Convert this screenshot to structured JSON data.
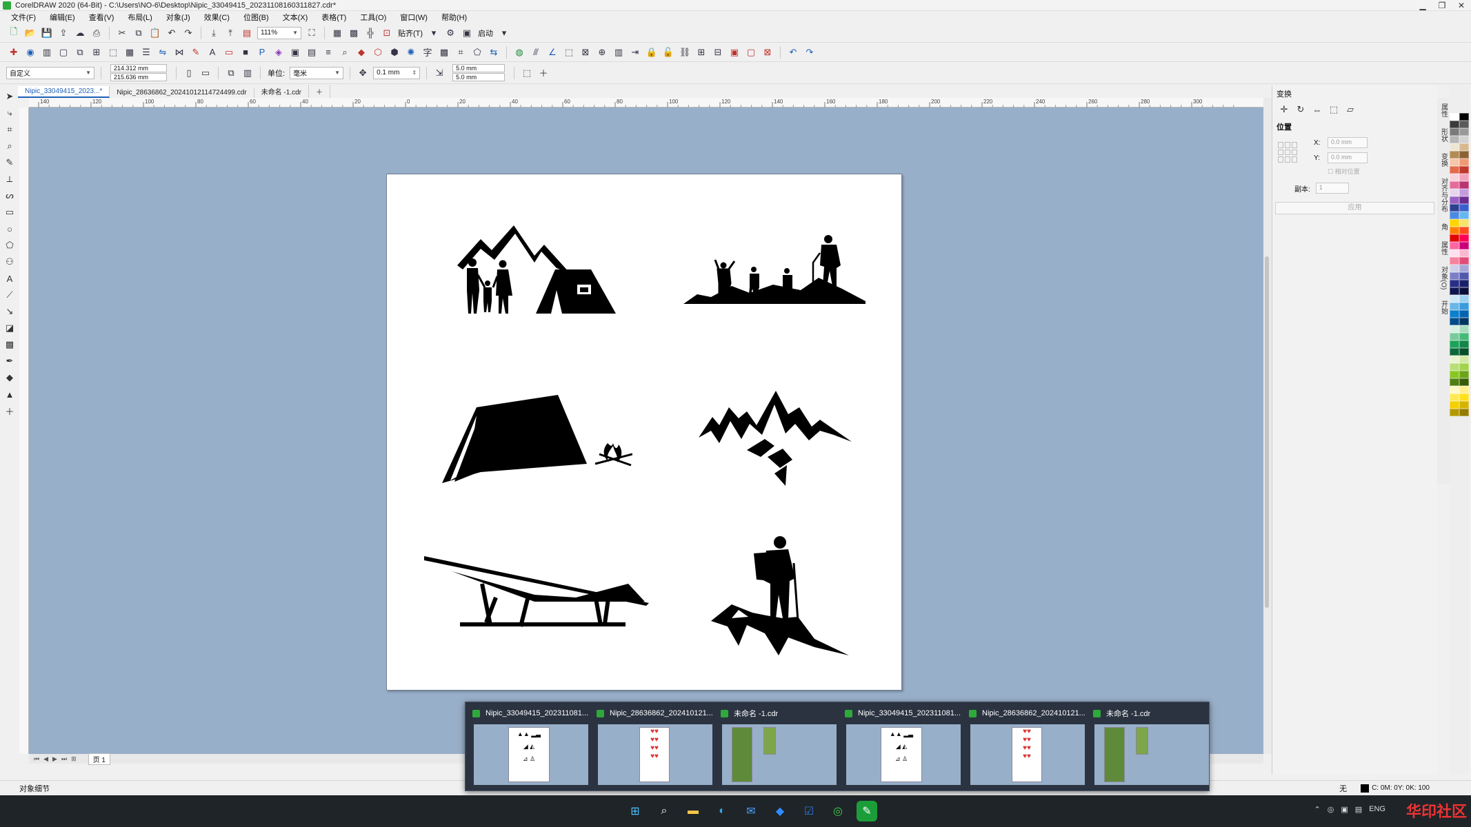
{
  "window": {
    "title": "CorelDRAW 2020 (64-Bit) - C:\\Users\\NO-6\\Desktop\\Nipic_33049415_20231108160311827.cdr*",
    "controls": [
      "▁",
      "❐",
      "✕"
    ]
  },
  "menu": [
    "文件(F)",
    "编辑(E)",
    "查看(V)",
    "布局(L)",
    "对象(J)",
    "效果(C)",
    "位图(B)",
    "文本(X)",
    "表格(T)",
    "工具(O)",
    "窗口(W)",
    "帮助(H)"
  ],
  "toolbar": {
    "zoom": "111%",
    "snap_label": "贴齐(T)",
    "launch_label": "启动"
  },
  "propbar": {
    "page_preset": "自定义",
    "width": "214.312 mm",
    "height": "215.636 mm",
    "unit_label": "单位:",
    "unit_value": "毫米",
    "nudge": "0.1 mm",
    "dup_x": "5.0 mm",
    "dup_y": "5.0 mm"
  },
  "doc_tabs": [
    {
      "label": "Nipic_33049415_2023...*",
      "active": true
    },
    {
      "label": "Nipic_28636862_20241012114724499.cdr",
      "active": false
    },
    {
      "label": "未命名 -1.cdr",
      "active": false
    }
  ],
  "ruler_top_labels": [
    "140",
    "120",
    "100",
    "80",
    "60",
    "40",
    "20",
    "0",
    "20",
    "40",
    "60",
    "80",
    "100",
    "120",
    "140",
    "160",
    "180",
    "200",
    "220",
    "240",
    "260",
    "280",
    "300"
  ],
  "page_nav": {
    "page_label": "页 1"
  },
  "docker": {
    "title": "变换",
    "section": "位置",
    "x_label": "X:",
    "x_value": "0.0 mm",
    "y_label": "Y:",
    "y_value": "0.0 mm",
    "relative_label": "相对位置",
    "copies_label": "副本:",
    "copies_value": "1",
    "apply_label": "应用"
  },
  "side_tabs": [
    "属性",
    "形状",
    "变换",
    "对齐与分布",
    "角",
    "属性",
    "对象(O)",
    "开始"
  ],
  "palette_colors": [
    "#ffffff",
    "#000000",
    "#3b3b3b",
    "#5a5a5a",
    "#7a7a7a",
    "#999999",
    "#b5b5b5",
    "#d2d2d2",
    "#ede4d3",
    "#d7b98e",
    "#b38b55",
    "#8a6234",
    "#f6c6a8",
    "#ef9a76",
    "#e36b4b",
    "#c0392b",
    "#f8d3dd",
    "#f2a3bb",
    "#e46c9a",
    "#b83570",
    "#e7d5ef",
    "#c69bde",
    "#9a5fc3",
    "#6a2d91",
    "#2e3f92",
    "#3a5fcd",
    "#4a8ae2",
    "#67b6ef",
    "#ffd400",
    "#f7e26b",
    "#ff7f00",
    "#ff4b1f",
    "#e10600",
    "#ff0055",
    "#ff66a3",
    "#c9007a",
    "#ffe0ef",
    "#fbb8cf",
    "#f5829f",
    "#de4e78",
    "#cfcfe8",
    "#a5a8d8",
    "#7b7fc5",
    "#5259ab",
    "#2a2f86",
    "#19206b",
    "#0f1550",
    "#0a0f38",
    "#cfe7f7",
    "#9fd0ef",
    "#6bb6e6",
    "#3a9bdd",
    "#0b7fd0",
    "#0064b0",
    "#004c8a",
    "#00335e",
    "#d7efe2",
    "#a9dcbf",
    "#7acb9c",
    "#48b878",
    "#1ca35a",
    "#138649",
    "#0c6a39",
    "#064d29",
    "#e9f4cf",
    "#d1e9a3",
    "#b9de78",
    "#a1d34d",
    "#88c722",
    "#6ca418",
    "#508010",
    "#365c08",
    "#fff8c7",
    "#fff08d",
    "#ffe854",
    "#ffe01b",
    "#f4d000",
    "#d4b400",
    "#b49800",
    "#947c00"
  ],
  "status": {
    "object_details": "对象细节",
    "fill": "无",
    "cmyk": "C: 0M: 0Y: 0K: 100"
  },
  "previews": [
    {
      "title": "Nipic_33049415_202311081...",
      "kind": "outdoor"
    },
    {
      "title": "Nipic_28636862_202410121...",
      "kind": "hearts"
    },
    {
      "title": "未命名 -1.cdr",
      "kind": "poster"
    },
    {
      "title": "Nipic_33049415_202311081...",
      "kind": "outdoor"
    },
    {
      "title": "Nipic_28636862_202410121...",
      "kind": "hearts"
    },
    {
      "title": "未命名 -1.cdr",
      "kind": "poster"
    }
  ],
  "taskbar": {
    "tray_lang": "ENG",
    "brand": "华印社区"
  }
}
